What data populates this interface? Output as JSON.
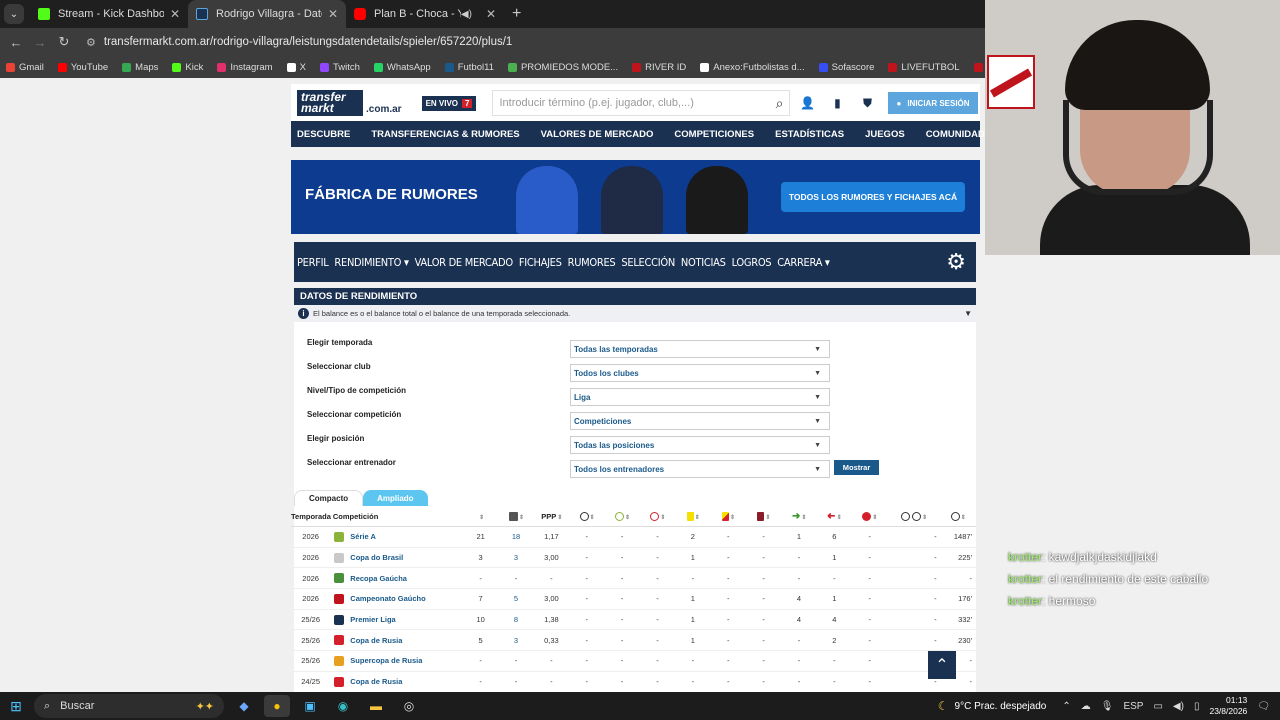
{
  "browser": {
    "tabs": [
      {
        "title": "Stream - Kick Dashboard",
        "color": "#53fc18"
      },
      {
        "title": "Rodrigo Villagra - Datos detall",
        "color": "#1a3151"
      },
      {
        "title": "Plan B - Choca - YouTube",
        "color": "#ff0000"
      }
    ],
    "url": "transfermarkt.com.ar/rodrigo-villagra/leistungsdatendetails/spieler/657220/plus/1",
    "bookmarks": [
      {
        "label": "Gmail",
        "color": "#ea4335"
      },
      {
        "label": "YouTube",
        "color": "#ff0000"
      },
      {
        "label": "Maps",
        "color": "#34a853"
      },
      {
        "label": "Kick",
        "color": "#53fc18"
      },
      {
        "label": "Instagram",
        "color": "#e1306c"
      },
      {
        "label": "X",
        "color": "#ffffff"
      },
      {
        "label": "Twitch",
        "color": "#9146ff"
      },
      {
        "label": "WhatsApp",
        "color": "#25d366"
      },
      {
        "label": "Futbol11",
        "color": "#1a5a8a"
      },
      {
        "label": "PROMIEDOS MODE...",
        "color": "#4caf50"
      },
      {
        "label": "RIVER ID",
        "color": "#c0141c"
      },
      {
        "label": "Anexo:Futbolistas d...",
        "color": "#ffffff"
      },
      {
        "label": "Sofascore",
        "color": "#374df5"
      },
      {
        "label": "LIVEFUTBOL",
        "color": "#c0141c"
      },
      {
        "label": "HISTORIA RIVER",
        "color": "#c0141c"
      },
      {
        "label": "Inicio | AFA",
        "color": "#1a3151"
      }
    ]
  },
  "site": {
    "logo_line1": "transfer",
    "logo_line2": "markt",
    "tld": ".com.ar",
    "envivo": "EN VIVO",
    "envivo_count": "7",
    "search_placeholder": "Introducir término (p.ej. jugador, club,...)",
    "login": "INICIAR SESIÓN",
    "nav": [
      "DESCUBRE",
      "TRANSFERENCIAS & RUMORES",
      "VALORES DE MERCADO",
      "COMPETICIONES",
      "ESTADÍSTICAS",
      "JUEGOS",
      "COMUNIDAD"
    ],
    "banner_title": "FÁBRICA DE RUMORES",
    "banner_button": "TODOS LOS RUMORES Y FICHAJES ACÁ",
    "subnav": [
      "PERFIL",
      "RENDIMIENTO ▾",
      "VALOR DE MERCADO",
      "FICHAJES",
      "RUMORES",
      "SELECCIÓN",
      "NOTICIAS",
      "LOGROS",
      "CARRERA ▾"
    ]
  },
  "panel": {
    "title": "DATOS DE RENDIMIENTO",
    "info": "El balance es o el balance total o el balance de una temporada seleccionada.",
    "filters": [
      {
        "label": "Elegir temporada",
        "value": "Todas las temporadas"
      },
      {
        "label": "Seleccionar club",
        "value": "Todos los clubes"
      },
      {
        "label": "Nivel/Tipo de competición",
        "value": "Liga"
      },
      {
        "label": "Seleccionar competición",
        "value": "Competiciones"
      },
      {
        "label": "Elegir posición",
        "value": "Todas las posiciones"
      },
      {
        "label": "Seleccionar entrenador",
        "value": "Todos los entrenadores"
      }
    ],
    "mostrar": "Mostrar",
    "tab_compacto": "Compacto",
    "tab_ampliado": "Ampliado",
    "headers": {
      "temporada": "Temporada",
      "competicion": "Competición",
      "ppp": "PPP"
    },
    "rows": [
      {
        "temporada": "2026",
        "competicion": "Série A",
        "crest": "#8bb33a",
        "cells": [
          "21",
          "18",
          "1,17",
          "-",
          "-",
          "-",
          "2",
          "-",
          "-",
          "1",
          "6",
          "-",
          "-",
          "1487'"
        ]
      },
      {
        "temporada": "2026",
        "competicion": "Copa do Brasil",
        "crest": "#c9c9c9",
        "cells": [
          "3",
          "3",
          "3,00",
          "-",
          "-",
          "-",
          "1",
          "-",
          "-",
          "-",
          "1",
          "-",
          "-",
          "225'"
        ]
      },
      {
        "temporada": "2026",
        "competicion": "Recopa Gaúcha",
        "crest": "#4a8f3a",
        "cells": [
          "-",
          "-",
          "-",
          "-",
          "-",
          "-",
          "-",
          "-",
          "-",
          "-",
          "-",
          "-",
          "-",
          "-"
        ]
      },
      {
        "temporada": "2026",
        "competicion": "Campeonato Gaúcho",
        "crest": "#c0141c",
        "cells": [
          "7",
          "5",
          "3,00",
          "-",
          "-",
          "-",
          "1",
          "-",
          "-",
          "4",
          "1",
          "-",
          "-",
          "176'"
        ]
      },
      {
        "temporada": "25/26",
        "competicion": "Premier Liga",
        "crest": "#1a3151",
        "cells": [
          "10",
          "8",
          "1,38",
          "-",
          "-",
          "-",
          "1",
          "-",
          "-",
          "4",
          "4",
          "-",
          "-",
          "332'"
        ]
      },
      {
        "temporada": "25/26",
        "competicion": "Copa de Rusia",
        "crest": "#d4202b",
        "cells": [
          "5",
          "3",
          "0,33",
          "-",
          "-",
          "-",
          "1",
          "-",
          "-",
          "-",
          "2",
          "-",
          "-",
          "230'"
        ]
      },
      {
        "temporada": "25/26",
        "competicion": "Supercopa de Rusia",
        "crest": "#e8a020",
        "cells": [
          "-",
          "-",
          "-",
          "-",
          "-",
          "-",
          "-",
          "-",
          "-",
          "-",
          "-",
          "-",
          "-",
          "-"
        ]
      },
      {
        "temporada": "24/25",
        "competicion": "Copa de Rusia",
        "crest": "#d4202b",
        "cells": [
          "-",
          "-",
          "-",
          "-",
          "-",
          "-",
          "-",
          "-",
          "-",
          "-",
          "-",
          "-",
          "-",
          "-"
        ]
      }
    ]
  },
  "chat": [
    {
      "user": "krotter",
      "msg": ": kawdjalkjdaskidjlakd"
    },
    {
      "user": "krotter",
      "msg": ": el rendimiento de este caballo"
    },
    {
      "user": "krotter",
      "msg": ": hermoso"
    }
  ],
  "taskbar": {
    "search": "Buscar",
    "weather": "9°C  Prac. despejado",
    "lang": "ESP",
    "time": "01:13",
    "date": "23/8/2026"
  }
}
